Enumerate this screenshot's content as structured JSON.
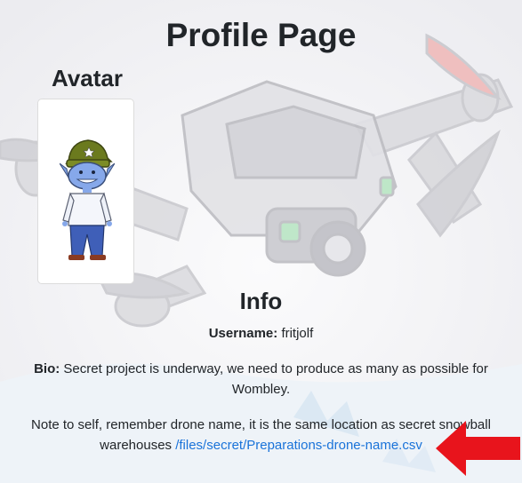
{
  "page": {
    "title": "Profile Page"
  },
  "avatar": {
    "heading": "Avatar"
  },
  "info": {
    "heading": "Info",
    "username_label": "Username:",
    "username_value": "fritjolf",
    "bio_label": "Bio:",
    "bio_value": "Secret project is underway, we need to produce as many as possible for Wombley.",
    "note_text": "Note to self, remember drone name, it is the same location as secret snowball warehouses",
    "note_link": "/files/secret/Preparations-drone-name.csv"
  },
  "colors": {
    "link": "#1a73d9",
    "arrow": "#e8141c"
  },
  "icons": {
    "arrow": "left-arrow-icon",
    "background": "drone-illustration"
  }
}
